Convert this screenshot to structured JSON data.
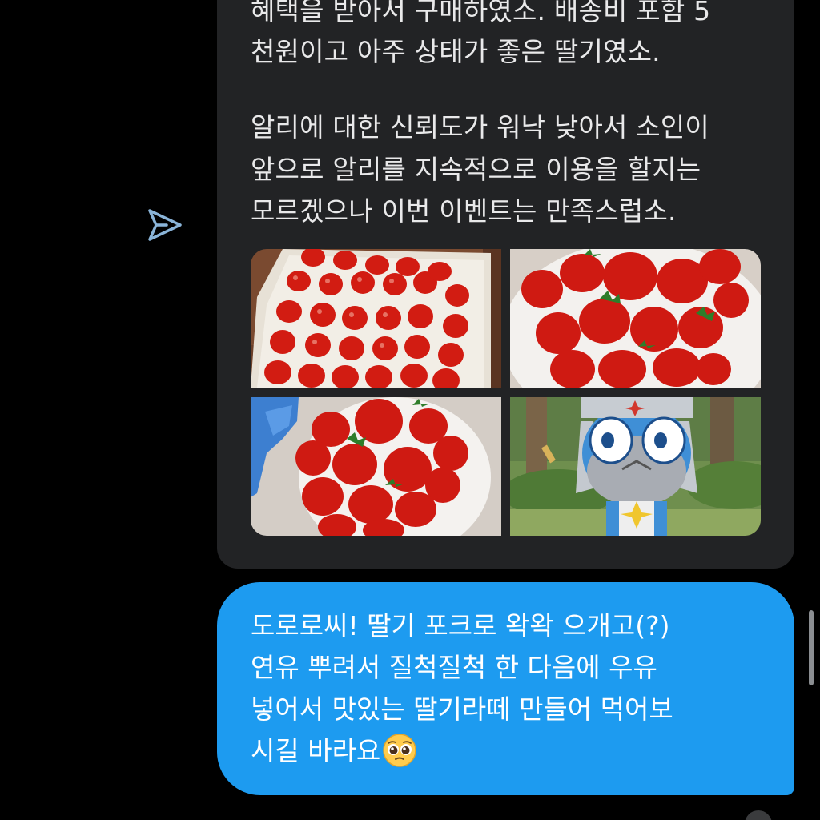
{
  "received_message": {
    "lines": [
      "혜택을 받아서 구매하였소. 배송비 포함 5",
      "천원이고 아주 상태가 좋은 딸기였소.",
      "",
      "알리에 대한 신뢰도가 워낙 낮아서 소인이",
      "앞으로 알리를 지속적으로 이용을 할지는",
      "모르겠으나 이번 이벤트는 만족스럽소."
    ]
  },
  "sent_message": {
    "lines": [
      "도로로씨! 딸기 포크로 왁왁 으개고(?)",
      "연유 뿌려서 질척질척 한 다음에 우유",
      "넣어서 맛있는 딸기라떼 만들어 먹어보",
      "시길 바라요"
    ],
    "emoji": "pleading-face-emoji"
  },
  "icons": {
    "share": "share-send-icon"
  },
  "colors": {
    "background": "#000000",
    "received_bubble": "#222325",
    "sent_bubble": "#1d9bf0",
    "text_light": "#e9e9ea",
    "share_icon": "#8ab4d8"
  }
}
